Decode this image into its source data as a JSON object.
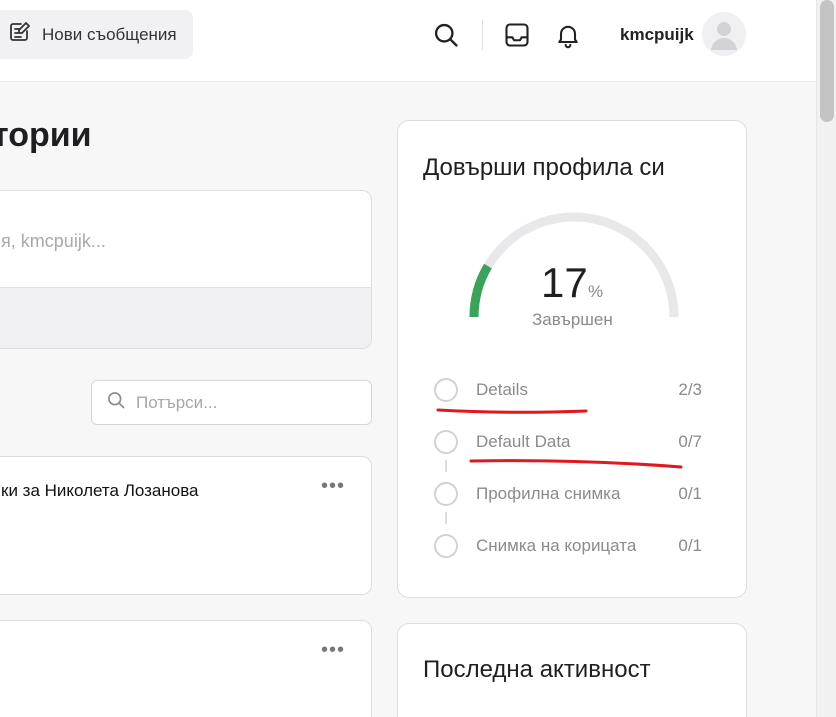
{
  "header": {
    "new_messages_label": "Нови съобщения",
    "username": "kmcpuijk"
  },
  "main": {
    "page_title_fragment": "тории",
    "composer_placeholder": "ия, kmcpuijk...",
    "search_placeholder": "Потърси...",
    "posts": [
      {
        "text": "ки за Николета Лозанова",
        "more": "•••"
      },
      {
        "text": "",
        "more": "•••"
      }
    ]
  },
  "profile_widget": {
    "title": "Довърши профила си",
    "percent": 17,
    "percent_sign": "%",
    "completed_label": "Завършен",
    "progress_color": "#3aa35b",
    "steps": [
      {
        "name": "Details",
        "count": "2/3"
      },
      {
        "name": "Default Data",
        "count": "0/7"
      },
      {
        "name": "Профилна снимка",
        "count": "0/1"
      },
      {
        "name": "Снимка на корицата",
        "count": "0/1"
      }
    ],
    "annotation_color": "#e0191f"
  },
  "activity_widget": {
    "title": "Последна активност"
  }
}
